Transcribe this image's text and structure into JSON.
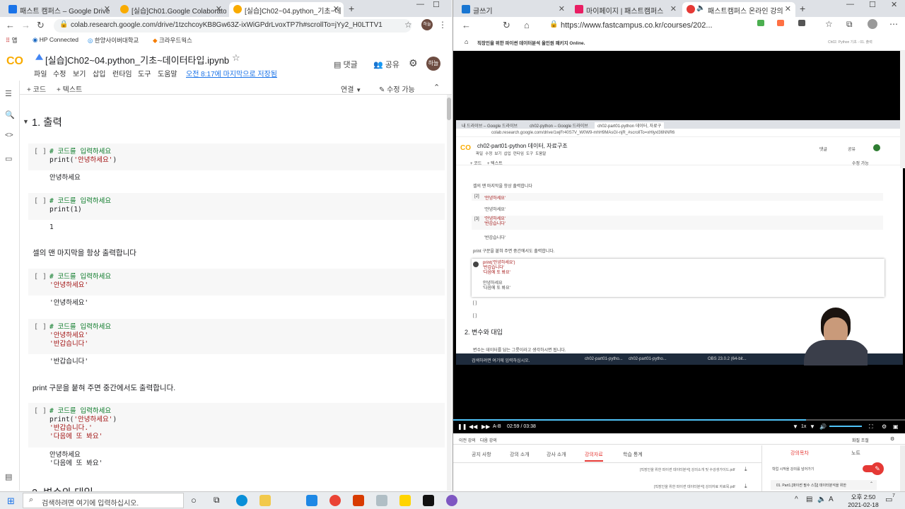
{
  "left_window": {
    "tabs": [
      {
        "label": "패스트 캠퍼스 – Google Drive",
        "color": "#1a73e8"
      },
      {
        "label": "[실습]Ch01.Google Colaborator",
        "color": "#f9ab00"
      },
      {
        "label": "[실습]Ch02~04.python_기초~데",
        "color": "#f9ab00",
        "active": true
      }
    ],
    "new_tab": "+",
    "window_controls": {
      "minimize": "—",
      "maximize": "☐",
      "close": "✕"
    },
    "url": "colab.research.google.com/drive/1tzchcoyKB8Gw63Z-ixWiGPdrLvoxTP7h#scrollTo=jYy2_H0LTTV1",
    "bookmarks": [
      {
        "label": "앱"
      },
      {
        "label": "HP Connected"
      },
      {
        "label": "한양사이버대학교"
      },
      {
        "label": "크라우드웍스"
      }
    ],
    "avatar": "하늘",
    "colab": {
      "logo": "CO",
      "title": "[실습]Ch02~04.python_기초~데이터타입.ipynb",
      "star": "☆",
      "comment_label": "댓글",
      "share_label": "공유",
      "menu": [
        "파일",
        "수정",
        "보기",
        "삽입",
        "런타임",
        "도구",
        "도움말"
      ],
      "saved_status": "오전 8:17에 마지막으로 저장됨",
      "add_code": "+ 코드",
      "add_text": "+ 텍스트",
      "connect_label": "연결",
      "edit_label": "수정 가능"
    },
    "notebook": {
      "section1": "1. 출력",
      "cells": [
        {
          "bracket": "[ ]",
          "lines": [
            {
              "t": "# 코드를 입력하세요",
              "c": "cm"
            },
            {
              "t": "print('안녕하세요')",
              "c": "mix"
            }
          ],
          "output": "안녕하세요"
        },
        {
          "bracket": "[ ]",
          "lines": [
            {
              "t": "# 코드를 입력하세요",
              "c": "cm"
            },
            {
              "t": "print(1)",
              "c": "pl"
            }
          ],
          "output": "1"
        },
        {
          "bracket": "[ ]",
          "lines": [
            {
              "t": "# 코드를 입력하세요",
              "c": "cm"
            },
            {
              "t": "'안녕하세요'",
              "c": "st"
            }
          ],
          "output": "'안녕하세요'"
        },
        {
          "bracket": "[ ]",
          "lines": [
            {
              "t": "# 코드를 입력하세요",
              "c": "cm"
            },
            {
              "t": "'안녕하세요'",
              "c": "st"
            },
            {
              "t": "'반갑습니다'",
              "c": "st"
            }
          ],
          "output": "'반갑습니다'"
        },
        {
          "bracket": "[ ]",
          "lines": [
            {
              "t": "# 코드를 입력하세요",
              "c": "cm"
            },
            {
              "t": "print('안녕하세요')",
              "c": "mix"
            },
            {
              "t": "'반갑습니다.'",
              "c": "st"
            },
            {
              "t": "'다음에 또 봐요'",
              "c": "st"
            }
          ],
          "output": "안녕하세요\n'다음에 또 봐요'"
        }
      ],
      "text1": "셀의 맨 마지막을 항상 출력합니다",
      "text2": "print 구문을 붙혀 주면 중간에서도 출력합니다.",
      "section2": "2. 변수와 대입"
    }
  },
  "right_window": {
    "tabs": [
      {
        "label": "글쓰기",
        "color": "#1976d2"
      },
      {
        "label": "마이페이지 | 패스트캠퍼스",
        "color": "#e91e63"
      },
      {
        "label": "패스트캠퍼스 온라인 강의",
        "color": "#e53935",
        "active": true
      }
    ],
    "url": "https://www.fastcampus.co.kr/courses/202...",
    "course_header": "직장인을 위한 파이썬 데이터분석 올인원 패키지 Online.",
    "course_header_right": "Ch02. Python 기초 - 01. 출력",
    "inner": {
      "tabs": [
        "내 드라이브 – Google 드라이브",
        "ch02-python – Google 드라이브",
        "ch02-part01-python 데이터, 자료구"
      ],
      "url": "colab.research.google.com/drive/1wjFr40S7V_W0W9-mhH9MAsGI-njR_#scrollTo=xHlyxl36NNR6",
      "title": "ch02-part01-python 데이터, 자료구조",
      "menu": [
        "파일",
        "수정",
        "보기",
        "삽입",
        "런타임",
        "도구",
        "도움말"
      ],
      "add_code": "+ 코드",
      "add_text": "+ 텍스트",
      "comment": "댓글",
      "share": "공유",
      "edit": "수정 가능",
      "text1": "셀의 맨 마지막을 항상 출력합니다",
      "cells": [
        {
          "b": "[2]",
          "code": "'안녕하세요'",
          "out": "'안녕하세요'"
        },
        {
          "b": "[3]",
          "code": "'안녕하세요'\n'반갑습니다'",
          "out": "'반갑습니다'"
        }
      ],
      "text2": "print 구문을 붙혀 주면 중간에서도 출력합니다.",
      "active_code": "print('안녕하세요')\n'반갑습니다'\n'다음에 또 봐요'",
      "active_out": "안녕하세요\n'다음에 또 봐요'",
      "empty1": "[ ]",
      "empty2": "[ ]",
      "section2": "2. 변수와 대입",
      "section2_sub": "변수는 데이터를 담는 그릇이라고 생각하시면 됩니다.",
      "taskbar_search": "검색하려면 여기에 입력하십시오.",
      "taskbar_items": [
        "ch02-part01-pytho...",
        "ch02-part01-pytho...",
        "OBS 23.0.2 (64-bit..."
      ]
    },
    "player": {
      "ab": "A-B",
      "time": "02:59 / 03:38",
      "speed": "1x",
      "progress": 0.78
    },
    "subnav": {
      "prev": "이전 강의",
      "next": "다음 강의",
      "report": "화질 조절"
    },
    "lower_tabs": [
      "공지 사항",
      "강의 소개",
      "강사 소개",
      "강의자료",
      "학습 통계"
    ],
    "files": [
      "[직장인을 위한 파이썬 데이터분석] 강의소개 및 수강생가이드.pdf",
      "[직장인을 위한 파이썬 데이터분석] 강의자료 자료목.pdf"
    ],
    "side_tabs": [
      "강의목차",
      "노트"
    ],
    "side_toggle_label": "학업 시작을 강의를 넘어가기",
    "side_item": "01. Part1.[파이썬 필수 스킬] 데이터분석을 위한"
  },
  "taskbar": {
    "search": "검색하려면 여기에 입력하십시오.",
    "clock_time": "오후 2:50",
    "clock_date": "2021-02-18",
    "lang": "A",
    "notif": "7"
  },
  "colors": {
    "colab_orange": "#f9ab00",
    "fastcampus_red": "#e53935",
    "comment_green": "#0b7a28",
    "string_red": "#a31515"
  }
}
